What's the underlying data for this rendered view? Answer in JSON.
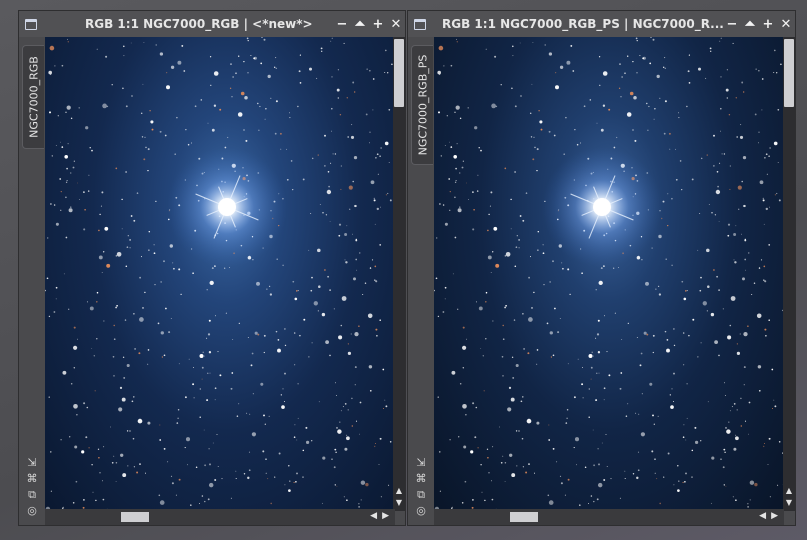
{
  "windows": [
    {
      "title": "RGB 1:1 NGC7000_RGB | <*new*>",
      "side_tab": "NGC7000_RGB",
      "buttons": {
        "minimize": "−",
        "shade": "⏶",
        "maximize": "+",
        "close": "✕"
      },
      "tools": {
        "fit": "⇲",
        "zoom": "⌘",
        "clone": "⧉",
        "mask": "◎"
      },
      "scroll": {
        "up": "▲",
        "down": "▼",
        "left": "◀",
        "right": "▶"
      }
    },
    {
      "title": "RGB 1:1 NGC7000_RGB_PS | NGC7000_R...",
      "side_tab": "NGC7000_RGB_PS",
      "buttons": {
        "minimize": "−",
        "shade": "⏶",
        "maximize": "+",
        "close": "✕"
      },
      "tools": {
        "fit": "⇲",
        "zoom": "⌘",
        "clone": "⧉",
        "mask": "◎"
      },
      "scroll": {
        "up": "▲",
        "down": "▼",
        "left": "◀",
        "right": "▶"
      }
    }
  ],
  "colors": {
    "sky_core": "#3c6aa6",
    "sky_edge": "#0a1830",
    "star": "#ffffff",
    "red_star": "#e08a5a"
  }
}
